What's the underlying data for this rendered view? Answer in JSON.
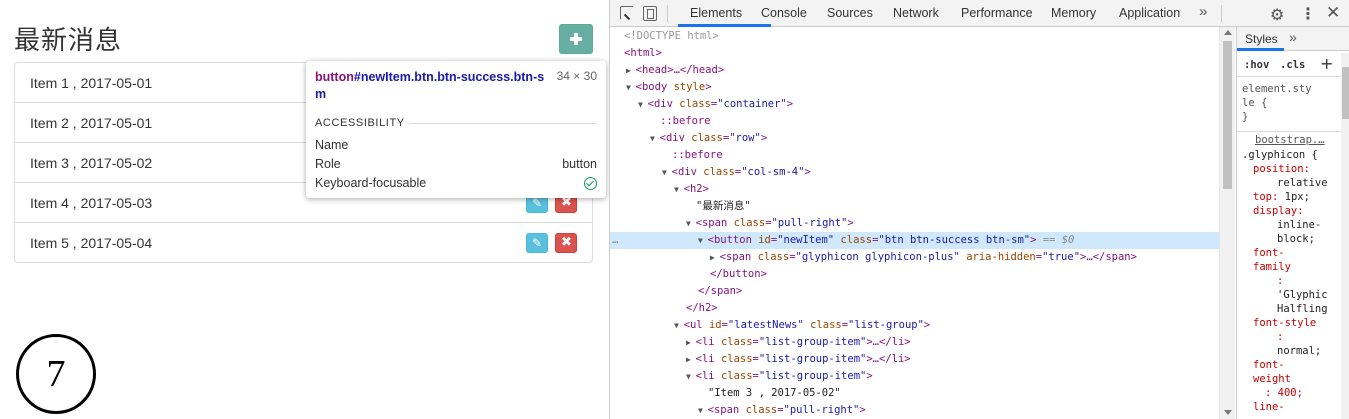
{
  "page": {
    "title": "最新消息",
    "items": [
      {
        "text": "Item 1 , 2017-05-01"
      },
      {
        "text": "Item 2 , 2017-05-01"
      },
      {
        "text": "Item 3 , 2017-05-02"
      },
      {
        "text": "Item 4 , 2017-05-03"
      },
      {
        "text": "Item 5 , 2017-05-04"
      }
    ],
    "step_number": "7",
    "colors": {
      "success": "#5cb85c",
      "info": "#5bc0de",
      "danger": "#d9534f"
    }
  },
  "tooltip": {
    "selector_tag": "button",
    "selector_rest": "#newItem.btn.btn-success.btn-sm",
    "size": "34 × 30",
    "section": "ACCESSIBILITY",
    "rows": [
      {
        "label": "Name",
        "value": ""
      },
      {
        "label": "Role",
        "value": "button"
      },
      {
        "label": "Keyboard-focusable",
        "value": "check-icon"
      }
    ]
  },
  "devtools": {
    "tabs": [
      "Elements",
      "Console",
      "Sources",
      "Network",
      "Performance",
      "Memory",
      "Application"
    ],
    "more_tabs": "»",
    "styles": {
      "tab_label": "Styles",
      "more": "»",
      "hov": ":hov",
      "cls": ".cls",
      "plus": "+",
      "element_style_1": "element.sty",
      "element_style_2": "le {",
      "element_style_3": "}",
      "source": "bootstrap.…",
      "selector": ".glyphicon {",
      "props": [
        {
          "name": "position:",
          "value": ""
        },
        {
          "name": "",
          "value": "relative"
        },
        {
          "name": "top:",
          "value": " 1px;"
        },
        {
          "name": "display:",
          "value": ""
        },
        {
          "name": "",
          "value": "inline-"
        },
        {
          "name": "",
          "value": "block;"
        },
        {
          "name": "font-",
          "value": ""
        },
        {
          "name": "family",
          "value": ""
        },
        {
          "name": ":",
          "value": ""
        },
        {
          "name": "",
          "value": "'Glyphic"
        },
        {
          "name": "",
          "value": "Halfling"
        },
        {
          "name": "font-style",
          "value": ""
        },
        {
          "name": ":",
          "value": ""
        },
        {
          "name": "",
          "value": "normal;"
        },
        {
          "name": "font-",
          "value": ""
        },
        {
          "name": "weight",
          "value": ""
        },
        {
          "name": ": 400;",
          "value": ""
        },
        {
          "name": "line-",
          "value": ""
        }
      ]
    },
    "dom": {
      "doctype": "<!DOCTYPE html>",
      "html": "<html>",
      "head_tag": "<head>",
      "head_end": "…</head>",
      "body_tag": "<body",
      "body_attr": "style",
      "body_close": ">",
      "div": "<div",
      "class_attr": "class",
      "container_val": "\"container\"",
      "row_val": "\"row\"",
      "col_val": "\"col-sm-4\"",
      "before": "::before",
      "h2": "<h2>",
      "h2_text": "\"最新消息\"",
      "span": "<span",
      "pull_right_val": "\"pull-right\"",
      "button": "<button",
      "id_attr": "id",
      "newitem_val": "\"newItem\"",
      "btn_val": "\"btn btn-success btn-sm\"",
      "eq0": "== $0",
      "glyph_val": "\"glyphicon glyphicon-plus\"",
      "aria_attr": "aria-hidden",
      "true_val": "\"true\"",
      "span_end": "…</span>",
      "button_close": "</button>",
      "span_close": "</span>",
      "h2_close": "</h2>",
      "ul": "<ul",
      "latest_val": "\"latestNews\"",
      "list_group_val": "\"list-group\"",
      "li": "<li",
      "lgi_val": "\"list-group-item\"",
      "li_end": "…</li>",
      "item3_text": "\"Item 3 , 2017-05-02\"",
      "gt": ">",
      "eq": "=",
      "dots": "…"
    }
  }
}
